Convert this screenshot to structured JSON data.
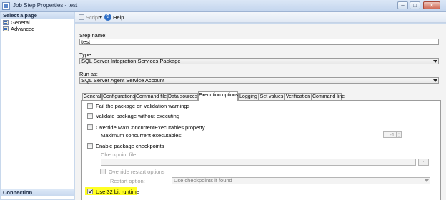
{
  "window": {
    "title": "Job Step Properties - test"
  },
  "left_pane": {
    "header": "Select a page",
    "items": [
      {
        "label": "General"
      },
      {
        "label": "Advanced"
      }
    ],
    "footer": "Connection"
  },
  "toolbar": {
    "script_label": "Script",
    "help_label": "Help"
  },
  "form": {
    "step_name_label": "Step name:",
    "step_name_value": "test",
    "type_label": "Type:",
    "type_value": "SQL Server Integration Services Package",
    "run_as_label": "Run as:",
    "run_as_value": "SQL Server Agent Service Account"
  },
  "tabs": [
    "General",
    "Configurations",
    "Command files",
    "Data sources",
    "Execution options",
    "Logging",
    "Set values",
    "Verification",
    "Command line"
  ],
  "active_tab": "Execution options",
  "execution_options": {
    "fail_on_warnings": "Fail the package on validation warnings",
    "validate_without_executing": "Validate package without executing",
    "override_max_concurrent": "Override MaxConcurrentExecutables property",
    "max_concurrent_label": "Maximum concurrent executables:",
    "max_concurrent_value": "-1",
    "enable_checkpoints": "Enable package checkpoints",
    "checkpoint_file_label": "Checkpoint file:",
    "checkpoint_file_value": "",
    "browse_label": "...",
    "override_restart": "Override restart options",
    "restart_option_label": "Restart option:",
    "restart_option_value": "Use checkpoints if found",
    "use_32bit": "Use 32 bit runtime",
    "use_32bit_checked": true
  },
  "colors": {
    "highlight": "#ffff24",
    "chrome": "#c8d8ec"
  }
}
